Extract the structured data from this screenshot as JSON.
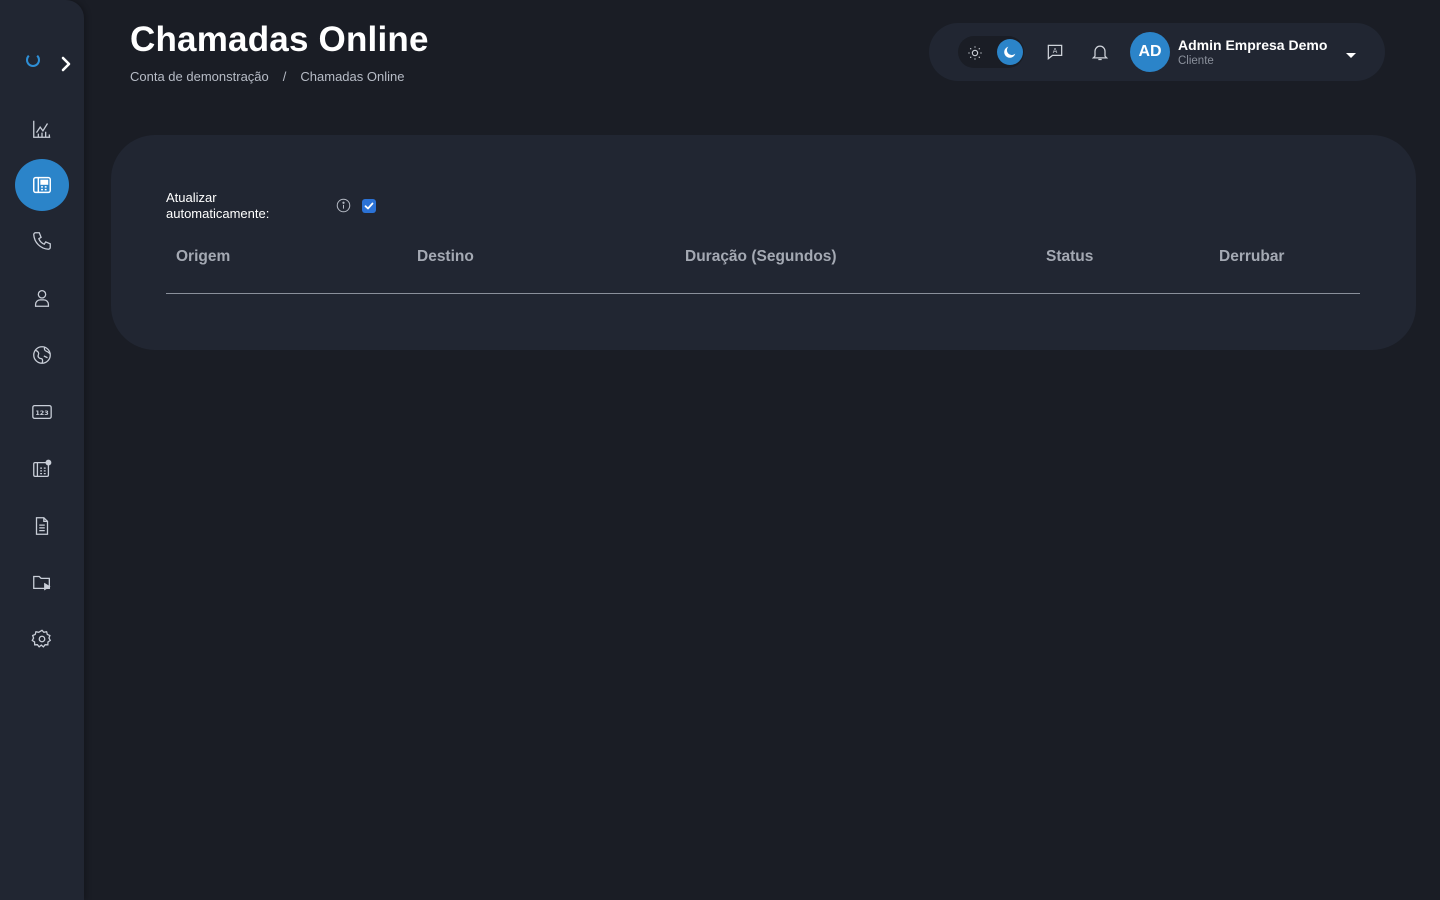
{
  "page": {
    "title": "Chamadas Online",
    "breadcrumb": [
      "Conta de demonstração",
      "/",
      "Chamadas Online"
    ]
  },
  "sidebar": {
    "items": [
      {
        "icon": "chart-icon",
        "active": false
      },
      {
        "icon": "online-calls-icon",
        "active": true
      },
      {
        "icon": "phone-icon",
        "active": false
      },
      {
        "icon": "user-icon",
        "active": false
      },
      {
        "icon": "globe-icon",
        "active": false
      },
      {
        "icon": "numbers-123-icon",
        "active": false
      },
      {
        "icon": "extensions-icon",
        "active": false
      },
      {
        "icon": "document-icon",
        "active": false
      },
      {
        "icon": "folder-play-icon",
        "active": false
      },
      {
        "icon": "gear-icon",
        "active": false
      }
    ]
  },
  "topbar": {
    "theme": "dark",
    "user": {
      "initials": "AD",
      "name": "Admin Empresa Demo",
      "role": "Cliente"
    }
  },
  "card": {
    "auto_refresh_label": "Atualizar automaticamente:",
    "auto_refresh_checked": true,
    "table": {
      "headers": [
        "Origem",
        "Destino",
        "Duração (Segundos)",
        "Status",
        "Derrubar"
      ],
      "rows": []
    }
  },
  "colors": {
    "accent": "#2b84c9",
    "background": "#1a1d25",
    "surface": "#212632"
  }
}
